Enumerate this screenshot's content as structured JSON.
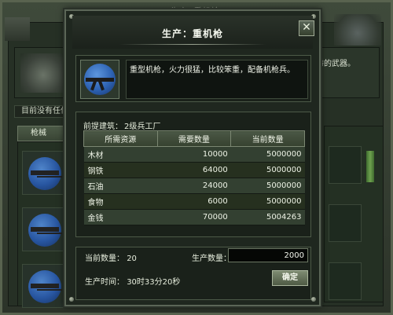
{
  "background": {
    "title": "生产 [重机枪]",
    "status_text": "目前没有任何",
    "tab_label": "枪械",
    "side_text": "秀的武器。"
  },
  "dialog": {
    "title": "生产：重机枪",
    "close_label": "✕",
    "description": "重型机枪，火力很猛，比较笨重，配备机枪兵。",
    "prerequisite_label": "前提建筑：",
    "prerequisite_value": "2级兵工厂",
    "table": {
      "headers": [
        "所需资源",
        "需要数量",
        "当前数量"
      ],
      "rows": [
        {
          "resource": "木材",
          "required": "10000",
          "current": "5000000"
        },
        {
          "resource": "钢铁",
          "required": "64000",
          "current": "5000000"
        },
        {
          "resource": "石油",
          "required": "24000",
          "current": "5000000"
        },
        {
          "resource": "食物",
          "required": "6000",
          "current": "5000000"
        },
        {
          "resource": "金钱",
          "required": "70000",
          "current": "5004263"
        }
      ]
    },
    "current_qty_label": "当前数量：",
    "current_qty_value": "20",
    "production_qty_label": "生产数量：",
    "production_qty_value": "2000",
    "production_time_label": "生产时间：",
    "production_time_value": "30时33分20秒",
    "confirm_label": "确定"
  }
}
